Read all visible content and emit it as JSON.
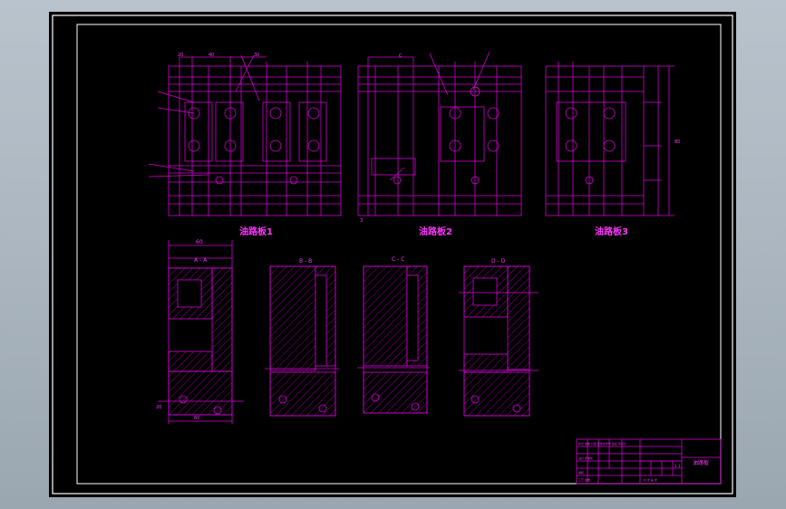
{
  "viewport": {
    "background": "#a9b4be",
    "canvas_background": "#000000"
  },
  "colors": {
    "line": "#d400d4",
    "frame": "#ffffff",
    "title_text": "#ff33ff"
  },
  "drawing": {
    "views": [
      {
        "title": "油路板1"
      },
      {
        "title": "油路板2"
      },
      {
        "title": "油路板3"
      }
    ],
    "sections": [
      {
        "label": "A - A",
        "dim_top": "60"
      },
      {
        "label": "B - B"
      },
      {
        "label": "C - C"
      },
      {
        "label": "D - D"
      }
    ],
    "dims_view1": [
      "20",
      "40",
      "30"
    ],
    "dims_view2": [
      "C",
      "3"
    ],
    "dims_view3": [
      "80"
    ],
    "dims_section_a": [
      "20",
      "60"
    ],
    "title_block": {
      "name": "油路板",
      "rows": [
        "标记 处数 分区 更改文件号 签名 年月日",
        "设计 标准化",
        "审核",
        "工艺 批准"
      ],
      "scale": "1:1",
      "sheet": "共 张 第 张"
    }
  }
}
